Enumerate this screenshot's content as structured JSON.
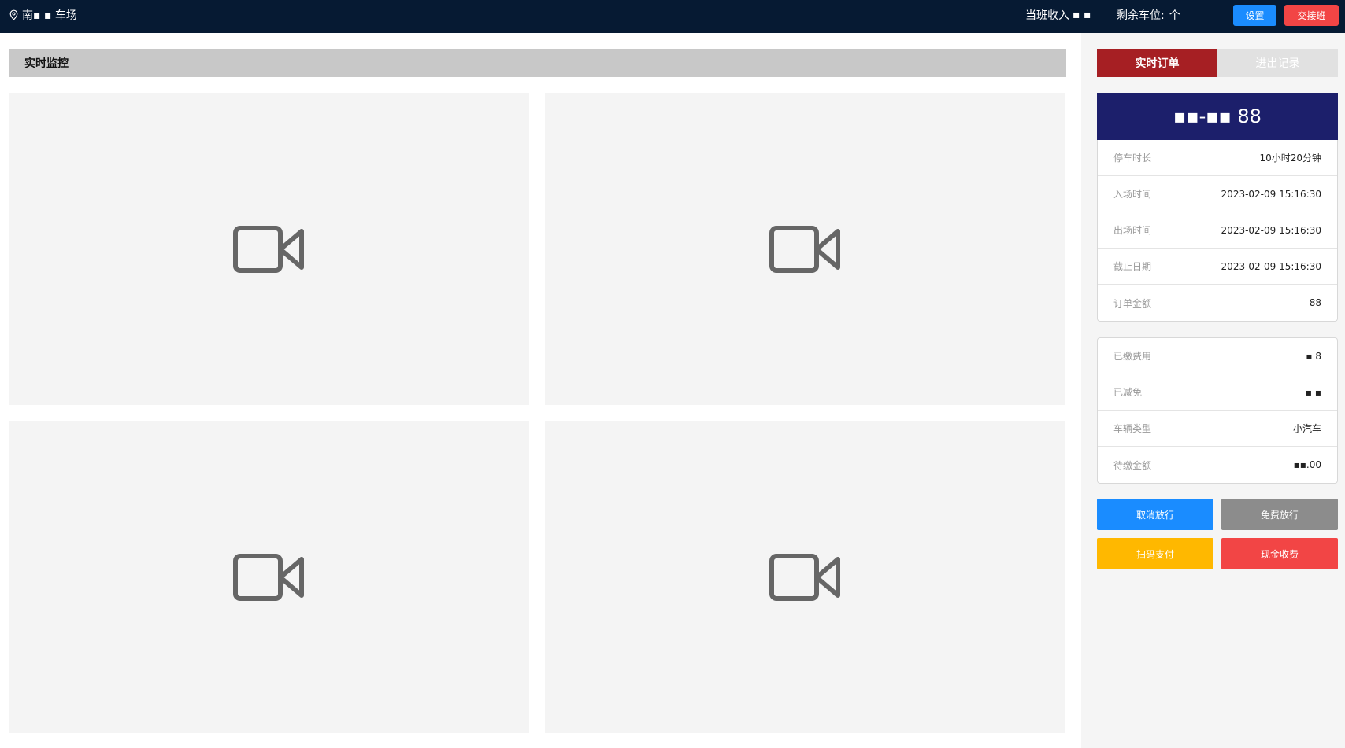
{
  "topbar": {
    "location_name": "南▪ ▪ 车场",
    "shift_income_label": "当班收入",
    "shift_income_value": "▪ ▪",
    "remaining_spaces_label": "剩余车位:",
    "remaining_spaces_value": "个",
    "settings_label": "设置",
    "handover_label": "交接班"
  },
  "main": {
    "section_title": "实时监控",
    "cameras": [
      "camera-1",
      "camera-2",
      "camera-3",
      "camera-4"
    ]
  },
  "sidebar": {
    "tabs": [
      {
        "label": "实时订单",
        "active": true
      },
      {
        "label": "进出记录",
        "active": false
      }
    ],
    "plate_number": "▪▪-▪▪ 88",
    "order_details": [
      {
        "label": "停车时长",
        "value": "10小时20分钟"
      },
      {
        "label": "入场时间",
        "value": "2023-02-09 15:16:30"
      },
      {
        "label": "出场时间",
        "value": "2023-02-09 15:16:30"
      },
      {
        "label": "截止日期",
        "value": "2023-02-09 15:16:30"
      },
      {
        "label": "订单金额",
        "value": "88"
      }
    ],
    "payment_details": [
      {
        "label": "已缴费用",
        "value": "▪ 8"
      },
      {
        "label": "已减免",
        "value": "▪ ▪"
      },
      {
        "label": "车辆类型",
        "value": "小汽车"
      },
      {
        "label": "待缴金额",
        "value": "▪▪.00"
      }
    ],
    "actions": {
      "cancel_release": "取消放行",
      "free_release": "免费放行",
      "scan_pay": "扫码支付",
      "cash_charge": "现金收费"
    }
  },
  "colors": {
    "topbar_bg": "#061a33",
    "settings_btn": "#1a8cff",
    "handover_btn": "#f24545",
    "active_tab": "#a61f23",
    "plate_bg": "#1c1f6b",
    "cancel_release": "#1a8cff",
    "free_release": "#8c8c8c",
    "scan_pay": "#ffb800",
    "cash_charge": "#f24545"
  },
  "icons": {
    "location": "location-pin-icon",
    "camera": "video-camera-icon"
  }
}
